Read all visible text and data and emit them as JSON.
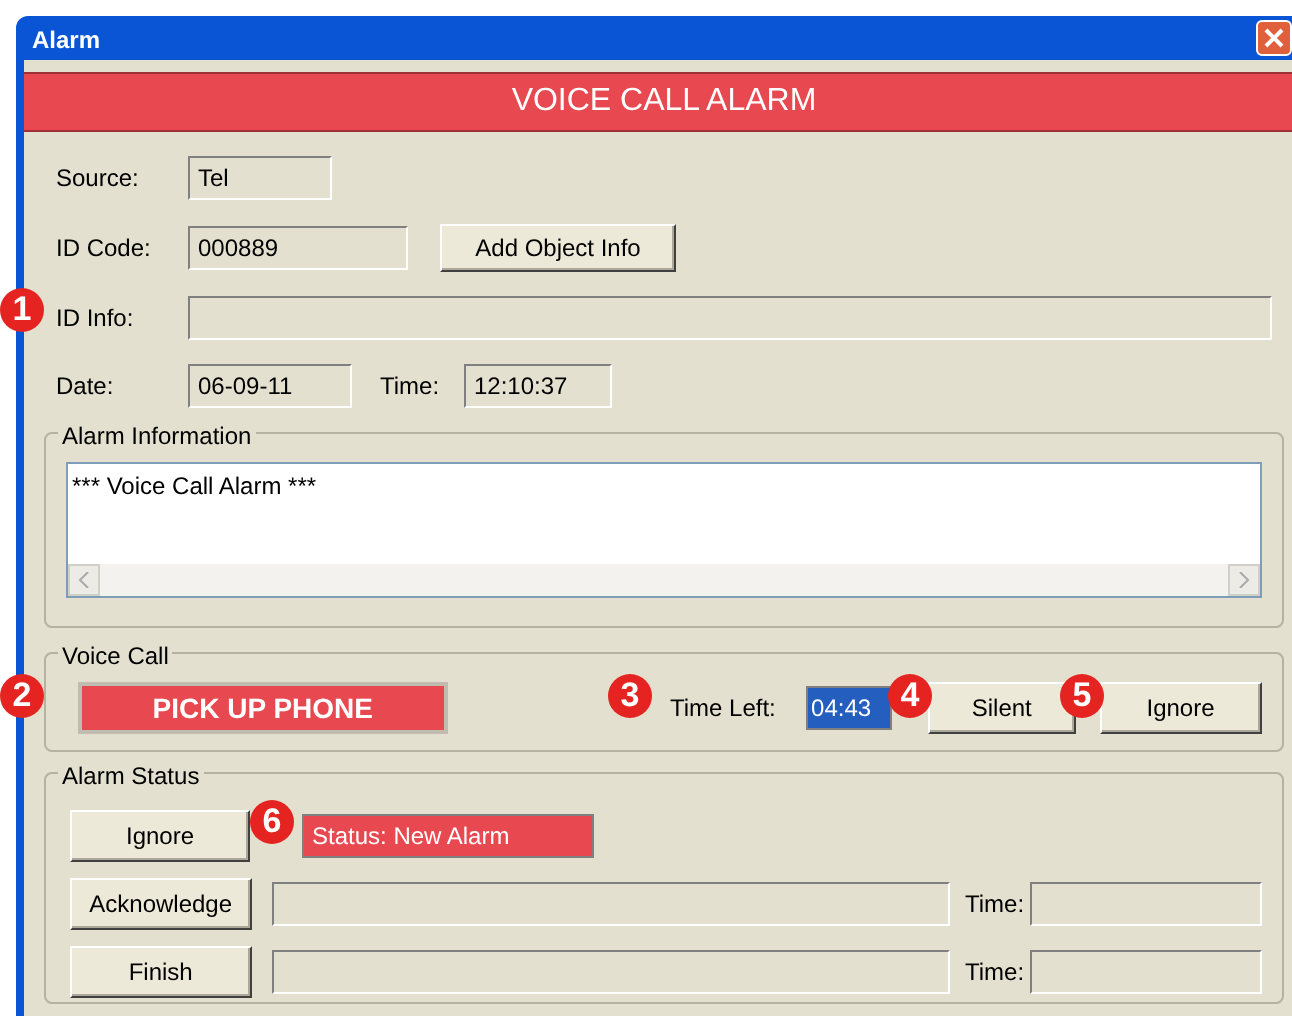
{
  "window": {
    "title": "Alarm"
  },
  "banner": "VOICE CALL ALARM",
  "fields": {
    "source_label": "Source:",
    "source": "Tel",
    "id_code_label": "ID Code:",
    "id_code": "000889",
    "add_object_info": "Add Object Info",
    "id_info_label": "ID Info:",
    "date_label": "Date:",
    "date": "06-09-11",
    "time_label": "Time:",
    "time": "12:10:37"
  },
  "alarm_information": {
    "title": "Alarm Information",
    "text": "*** Voice Call Alarm ***"
  },
  "voice_call": {
    "title": "Voice Call",
    "pick_up": "PICK UP PHONE",
    "time_left_label": "Time Left:",
    "time_left": "04:43",
    "silent": "Silent",
    "ignore": "Ignore"
  },
  "alarm_status": {
    "title": "Alarm Status",
    "ignore": "Ignore",
    "status": "Status: New Alarm",
    "rows": [
      {
        "button": "Acknowledge",
        "time_label": "Time:"
      },
      {
        "button": "Finish",
        "time_label": "Time:"
      }
    ]
  },
  "callouts": [
    "1",
    "2",
    "3",
    "4",
    "5",
    "6"
  ]
}
